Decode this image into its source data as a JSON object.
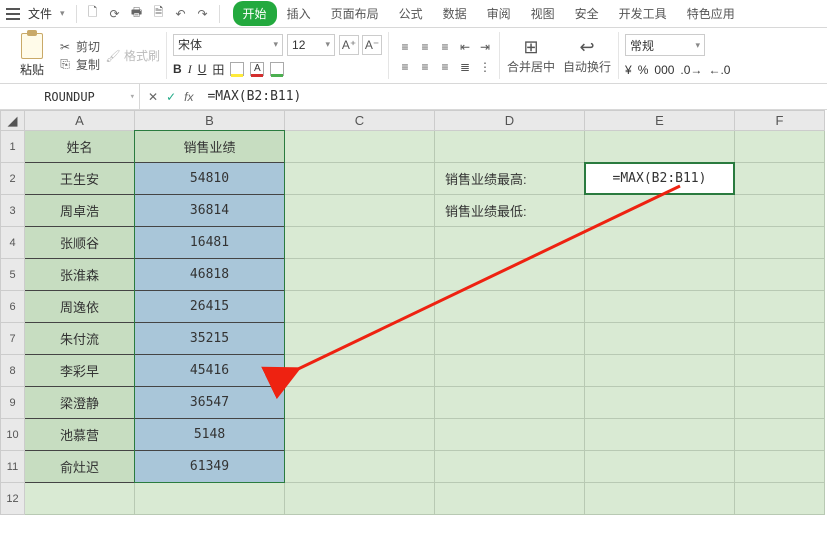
{
  "menu": {
    "file": "文件",
    "tabs": [
      "开始",
      "插入",
      "页面布局",
      "公式",
      "数据",
      "审阅",
      "视图",
      "安全",
      "开发工具",
      "特色应用"
    ]
  },
  "ribbon": {
    "paste": "粘贴",
    "cut": "剪切",
    "copy": "复制",
    "format_painter": "格式刷",
    "font": "宋体",
    "font_size": "12",
    "merge": "合并居中",
    "wrap": "自动换行",
    "num_format": "常规"
  },
  "formula_bar": {
    "name": "ROUNDUP",
    "formula": "=MAX(B2:B11)"
  },
  "columns": [
    "A",
    "B",
    "C",
    "D",
    "E",
    "F"
  ],
  "headers": {
    "A": "姓名",
    "B": "销售业绩"
  },
  "labels": {
    "D2": "销售业绩最高:",
    "D3": "销售业绩最低:"
  },
  "e2": "=MAX(B2:B11)",
  "chart_data": {
    "type": "table",
    "columns": [
      "姓名",
      "销售业绩"
    ],
    "rows": [
      [
        "王生安",
        54810
      ],
      [
        "周卓浩",
        36814
      ],
      [
        "张顺谷",
        16481
      ],
      [
        "张淮森",
        46818
      ],
      [
        "周逸依",
        26415
      ],
      [
        "朱付流",
        35215
      ],
      [
        "李彩早",
        45416
      ],
      [
        "梁澄静",
        36547
      ],
      [
        "池慕营",
        5148
      ],
      [
        "俞灶迟",
        61349
      ]
    ]
  }
}
